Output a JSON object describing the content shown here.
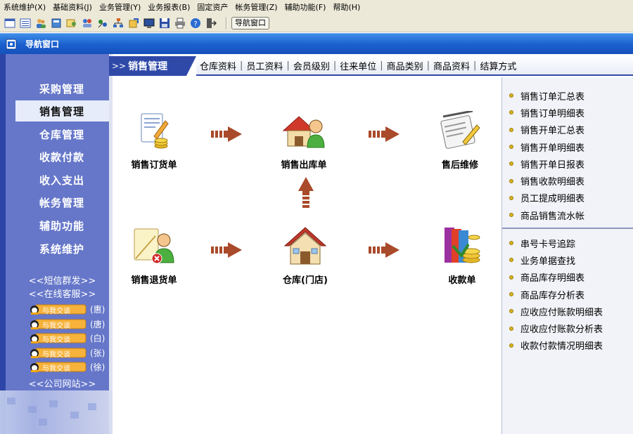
{
  "menu": [
    "系统维护(X)",
    "基础资料(J)",
    "业务管理(Y)",
    "业务报表(B)",
    "固定资产",
    "帐务管理(Z)",
    "辅助功能(F)",
    "帮助(H)"
  ],
  "toolbar": {
    "icons": [
      "window-icon",
      "list-icon",
      "people-icon",
      "book-icon",
      "users-icon",
      "clients-icon",
      "transfer-icon",
      "hierarchy-icon",
      "export-icon",
      "monitor-icon",
      "save-icon",
      "print-icon",
      "help-icon",
      "exit-icon"
    ],
    "nav_window_label": "导航窗口"
  },
  "title_strip": {
    "title": "导航窗口"
  },
  "sidebar": {
    "items": [
      "采购管理",
      "销售管理",
      "仓库管理",
      "收款付款",
      "收入支出",
      "帐务管理",
      "辅助功能",
      "系统维护"
    ],
    "active_index": 1,
    "sms_link": "<<短信群发>>",
    "service_link": "<<在线客服>>",
    "qq_button_text": "与我交谈",
    "qq_contacts": [
      "(惠)",
      "(唐)",
      "(白)",
      "(张)",
      "(徐)"
    ],
    "website_link": "<<公司网站>>"
  },
  "header": {
    "prefix": ">>",
    "current": "销售管理",
    "links": [
      "仓库资料",
      "员工资料",
      "会员级别",
      "往来单位",
      "商品类别",
      "商品资料",
      "结算方式"
    ]
  },
  "flow": {
    "sales_order": "销售订货单",
    "sales_outbound": "销售出库单",
    "after_sales": "售后维修",
    "sales_return": "销售退货单",
    "warehouse": "仓库(门店)",
    "receipt": "收款单"
  },
  "reports_top": [
    "销售订单汇总表",
    "销售订单明细表",
    "销售开单汇总表",
    "销售开单明细表",
    "销售开单日报表",
    "销售收款明细表",
    "员工提成明细表",
    "商品销售流水帐"
  ],
  "reports_bottom": [
    "串号卡号追踪",
    "业务单据查找",
    "商品库存明细表",
    "商品库存分析表",
    "应收应付账款明细表",
    "应收应付账款分析表",
    "收款付款情况明细表"
  ],
  "colors": {
    "sidebar_dark": "#2e45a8",
    "sidebar_mid": "#6677c9",
    "title_blue": "#1b5fce",
    "arrow": "#a94a2a",
    "bullet": "#d9b31e"
  }
}
